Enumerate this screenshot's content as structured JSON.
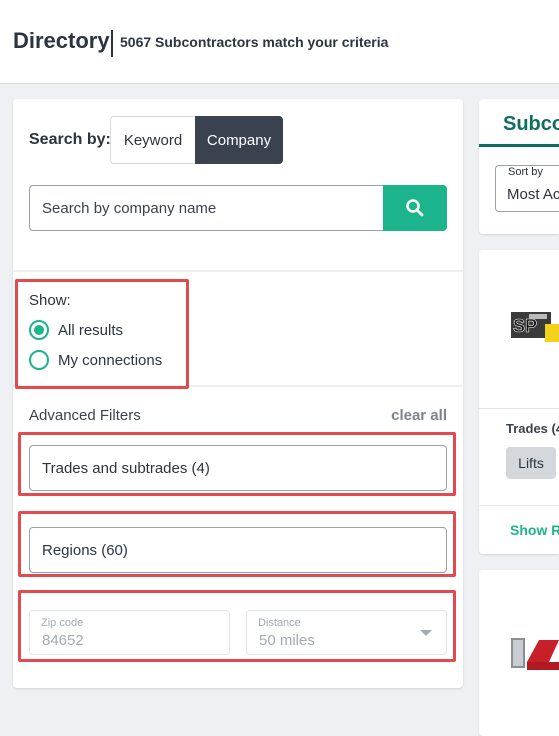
{
  "header": {
    "title": "Directory",
    "subtitle": "5067 Subcontractors match your criteria"
  },
  "search": {
    "by_label": "Search by:",
    "tabs": [
      "Keyword",
      "Company"
    ],
    "active_tab": "Company",
    "placeholder": "Search by company name"
  },
  "show": {
    "label": "Show:",
    "options": [
      "All results",
      "My connections"
    ],
    "selected": "All results"
  },
  "filters": {
    "title": "Advanced Filters",
    "clear_label": "clear all",
    "trades": "Trades and subtrades (4)",
    "regions": "Regions (60)",
    "zip_label": "Zip code",
    "zip_value": "84652",
    "distance_label": "Distance",
    "distance_value": "50 miles"
  },
  "results": {
    "title": "Subcontractors",
    "sort_label": "Sort by",
    "sort_value": "Most Active",
    "card1": {
      "trades": "Trades (4",
      "chip": "Lifts",
      "show_link": "Show Re"
    }
  },
  "colors": {
    "accent": "#1cb48c",
    "dark": "#3a4250",
    "highlight": "#e24a4f",
    "results_title": "#0f6e60"
  }
}
